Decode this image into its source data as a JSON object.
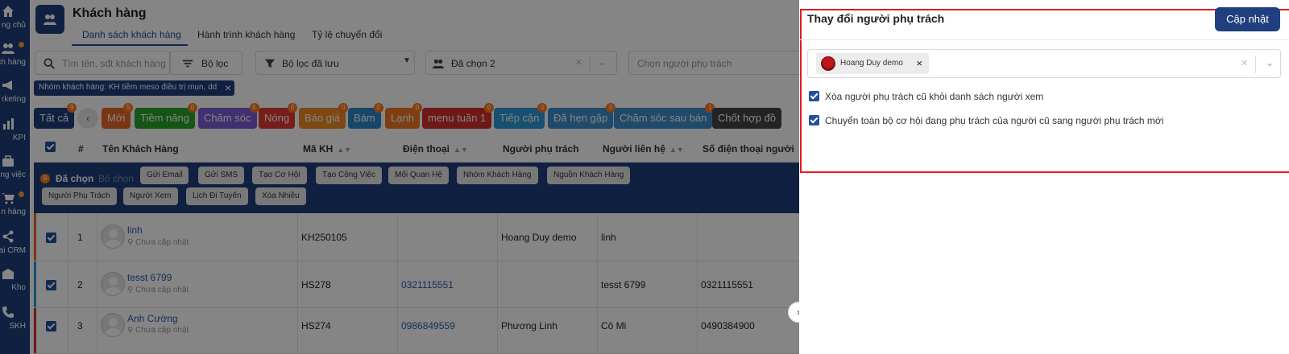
{
  "nav": {
    "items": [
      {
        "label": "ng chủ",
        "icon": "home-icon"
      },
      {
        "label": "ch hàng",
        "icon": "users-icon",
        "dot": true
      },
      {
        "label": "rketing",
        "icon": "megaphone-icon"
      },
      {
        "label": "KPI",
        "icon": "bar-chart-icon"
      },
      {
        "label": "ng việc",
        "icon": "briefcase-icon"
      },
      {
        "label": "n hàng",
        "icon": "cart-icon",
        "dot": true
      },
      {
        "label": "ai CRM",
        "icon": "share-icon"
      },
      {
        "label": "Kho",
        "icon": "warehouse-icon"
      },
      {
        "label": "SKH",
        "icon": "phone-icon"
      }
    ]
  },
  "header": {
    "title": "Khách hàng",
    "tabs": [
      "Danh sách khách hàng",
      "Hành trình khách hàng",
      "Tỷ lệ chuyển đổi"
    ]
  },
  "filters": {
    "search_placeholder": "Tìm tên, sđt khách hàng",
    "filter_label": "Bộ lọc",
    "saved_filter_label": "Bộ lọc đã lưu",
    "selected_label": "Đã chọn 2",
    "assignee_placeholder": "Chọn người phụ trách",
    "active_chip": "Nhóm khách hàng: KH tiềm meso điều trị mụn, dd"
  },
  "segments": [
    {
      "label": "Tất cả",
      "count": "9",
      "color": "#1f3f7e"
    },
    {
      "label": "Mới",
      "count": "5",
      "color": "#e8682a"
    },
    {
      "label": "Tiềm năng",
      "count": "0",
      "color": "#29a329"
    },
    {
      "label": "Chăm sóc",
      "count": "0",
      "color": "#7b5cd6"
    },
    {
      "label": "Nóng",
      "count": "0",
      "color": "#e53935"
    },
    {
      "label": "Báo giá",
      "count": "0",
      "color": "#f08a24"
    },
    {
      "label": "Bám",
      "count": "0",
      "color": "#2f86c9"
    },
    {
      "label": "Lạnh",
      "count": "0",
      "color": "#f07a24"
    },
    {
      "label": "menu tuần 1",
      "count": "0",
      "color": "#d32f2f"
    },
    {
      "label": "Tiếp cận",
      "count": "0",
      "color": "#2c9ad6"
    },
    {
      "label": "Đã hẹn gặp",
      "count": "0",
      "color": "#3f8fc9"
    },
    {
      "label": "Chăm sóc sau bán",
      "count": "1",
      "color": "#3f8fc9"
    },
    {
      "label": "Chốt hợp đồ",
      "count": "",
      "color": "#444444"
    }
  ],
  "table": {
    "columns": [
      "#",
      "Tên Khách Hàng",
      "Mã KH",
      "Điện thoại",
      "Người phụ trách",
      "Người liên hệ",
      "Số điện thoại người"
    ],
    "bulk": {
      "count": "9",
      "selected": "Đã chọn",
      "deselect": "Bỏ chọn",
      "actions_row1": [
        "Gửi Email",
        "Gửi SMS",
        "Tạo Cơ Hội",
        "Tạo Công Việc",
        "Mối Quan Hệ",
        "Nhóm Khách Hàng",
        "Nguồn Khách Hàng"
      ],
      "actions_row2": [
        "Người Phụ Trách",
        "Người Xem",
        "Lịch Đi Tuyến",
        "Xóa Nhiều"
      ]
    },
    "rows": [
      {
        "num": "1",
        "name": "linh",
        "sub": "Chưa cập nhật",
        "code": "KH250105",
        "phone": "",
        "assignee": "Hoang Duy demo",
        "contact": "linh",
        "contact_phone": "",
        "stripe": "#e8682a"
      },
      {
        "num": "2",
        "name": "tesst 6799",
        "sub": "Chưa cập nhật",
        "code": "HS278",
        "phone": "0321115551",
        "assignee": "",
        "contact": "tesst 6799",
        "contact_phone": "0321115551",
        "stripe": "#2c9ad6"
      },
      {
        "num": "3",
        "name": "Anh Cường",
        "sub": "Chưa cập nhật",
        "code": "HS274",
        "phone": "0986849559",
        "assignee": "Phương Linh",
        "contact": "Cô Mi",
        "contact_phone": "0490384900",
        "stripe": "#d32f2f"
      }
    ]
  },
  "panel": {
    "title": "Thay đổi người phụ trách",
    "update_button": "Cập nhật",
    "selected_user": "Hoang Duy demo",
    "options": [
      {
        "label": "Xóa người phụ trách cũ khỏi danh sách người xem",
        "checked": true
      },
      {
        "label": "Chuyển toàn bộ cơ hội đang phụ trách của người cũ sang người phụ trách mới",
        "checked": true
      }
    ]
  }
}
